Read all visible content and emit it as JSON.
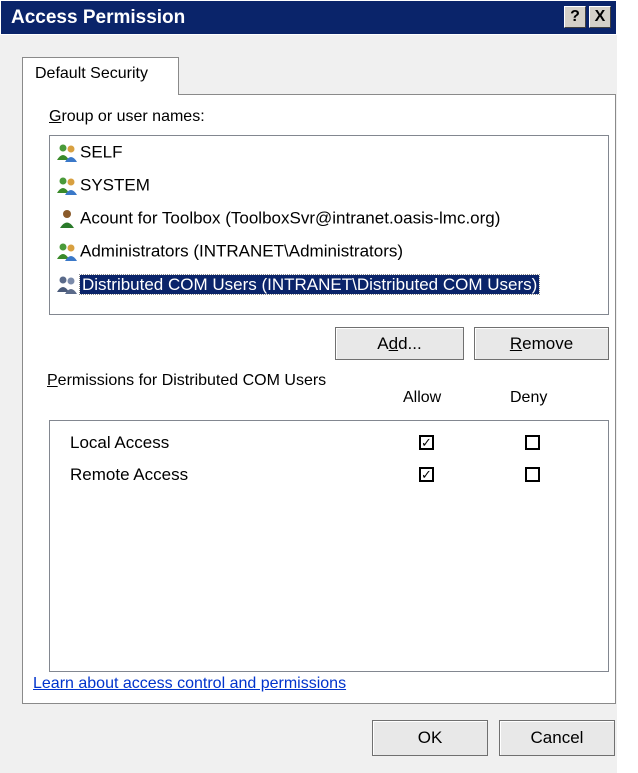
{
  "window": {
    "title": "Access Permission",
    "help_glyph": "?",
    "close_glyph": "X"
  },
  "tabs": [
    {
      "label": "Default Security",
      "active": true
    }
  ],
  "group_section": {
    "label_first": "G",
    "label_rest": "roup or user names:",
    "users": [
      {
        "name": "SELF",
        "icon": "group-users-icon",
        "selected": false
      },
      {
        "name": "SYSTEM",
        "icon": "group-users-icon",
        "selected": false
      },
      {
        "name": "Acount for Toolbox (ToolboxSvr@intranet.oasis-lmc.org)",
        "icon": "single-user-icon",
        "selected": false
      },
      {
        "name": "Administrators (INTRANET\\Administrators)",
        "icon": "group-users-icon",
        "selected": false
      },
      {
        "name": "Distributed COM Users (INTRANET\\Distributed COM Users)",
        "icon": "group-users-icon",
        "selected": true
      }
    ]
  },
  "buttons": {
    "add_pre": "A",
    "add_key": "d",
    "add_post": "d...",
    "remove_key": "R",
    "remove_post": "emove",
    "ok": "OK",
    "cancel": "Cancel"
  },
  "permissions": {
    "label_key": "P",
    "label_rest": "ermissions for Distributed COM Users",
    "col_allow": "Allow",
    "col_deny": "Deny",
    "rows": [
      {
        "name": "Local Access",
        "allow": true,
        "deny": false
      },
      {
        "name": "Remote Access",
        "allow": true,
        "deny": false
      }
    ]
  },
  "link": {
    "text": "Learn about access control and permissions"
  },
  "colors": {
    "title_bar": "#0a246a",
    "selection": "#0a246a",
    "link": "#0033cc",
    "dialog": "#f0f0f0"
  }
}
